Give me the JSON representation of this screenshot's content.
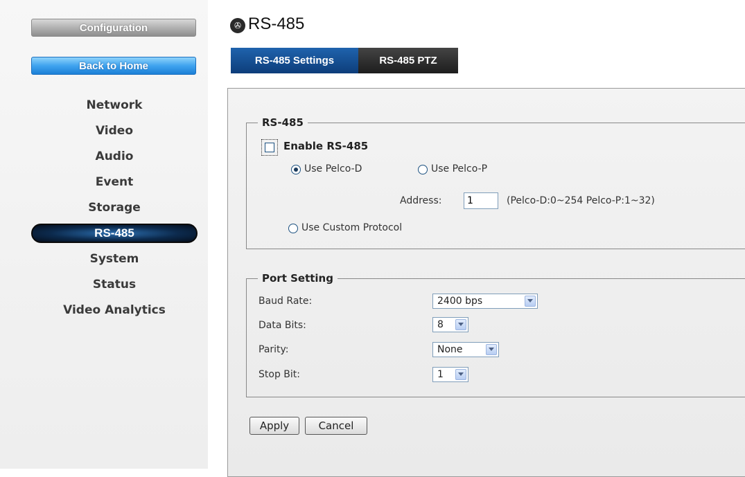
{
  "sidebar": {
    "config_label": "Configuration",
    "home_label": "Back to Home",
    "items": [
      {
        "label": "Network"
      },
      {
        "label": "Video"
      },
      {
        "label": "Audio"
      },
      {
        "label": "Event"
      },
      {
        "label": "Storage"
      },
      {
        "label": "RS-485",
        "active": true
      },
      {
        "label": "System"
      },
      {
        "label": "Status"
      },
      {
        "label": "Video Analytics"
      }
    ]
  },
  "header": {
    "title": "RS-485",
    "icon": "camera-badge-icon"
  },
  "tabs": [
    {
      "label": "RS-485 Settings",
      "active": true
    },
    {
      "label": "RS-485 PTZ"
    }
  ],
  "rs485": {
    "legend": "RS-485",
    "enable_label": "Enable RS-485",
    "enable_checked": false,
    "pelco_d_label": "Use Pelco-D",
    "pelco_p_label": "Use Pelco-P",
    "selected_protocol": "pelco_d",
    "address_label": "Address:",
    "address_value": "1",
    "address_hint": "(Pelco-D:0~254 Pelco-P:1~32)",
    "custom_label": "Use Custom Protocol"
  },
  "port": {
    "legend": "Port Setting",
    "baud_label": "Baud Rate:",
    "baud_value": "2400 bps",
    "data_bits_label": "Data Bits:",
    "data_bits_value": "8",
    "parity_label": "Parity:",
    "parity_value": "None",
    "stop_bit_label": "Stop Bit:",
    "stop_bit_value": "1"
  },
  "actions": {
    "apply": "Apply",
    "cancel": "Cancel"
  },
  "colors": {
    "active_tab": "#0d3d7a",
    "home_button": "#3fa3ef",
    "nav_active": "#0c2a4d"
  }
}
